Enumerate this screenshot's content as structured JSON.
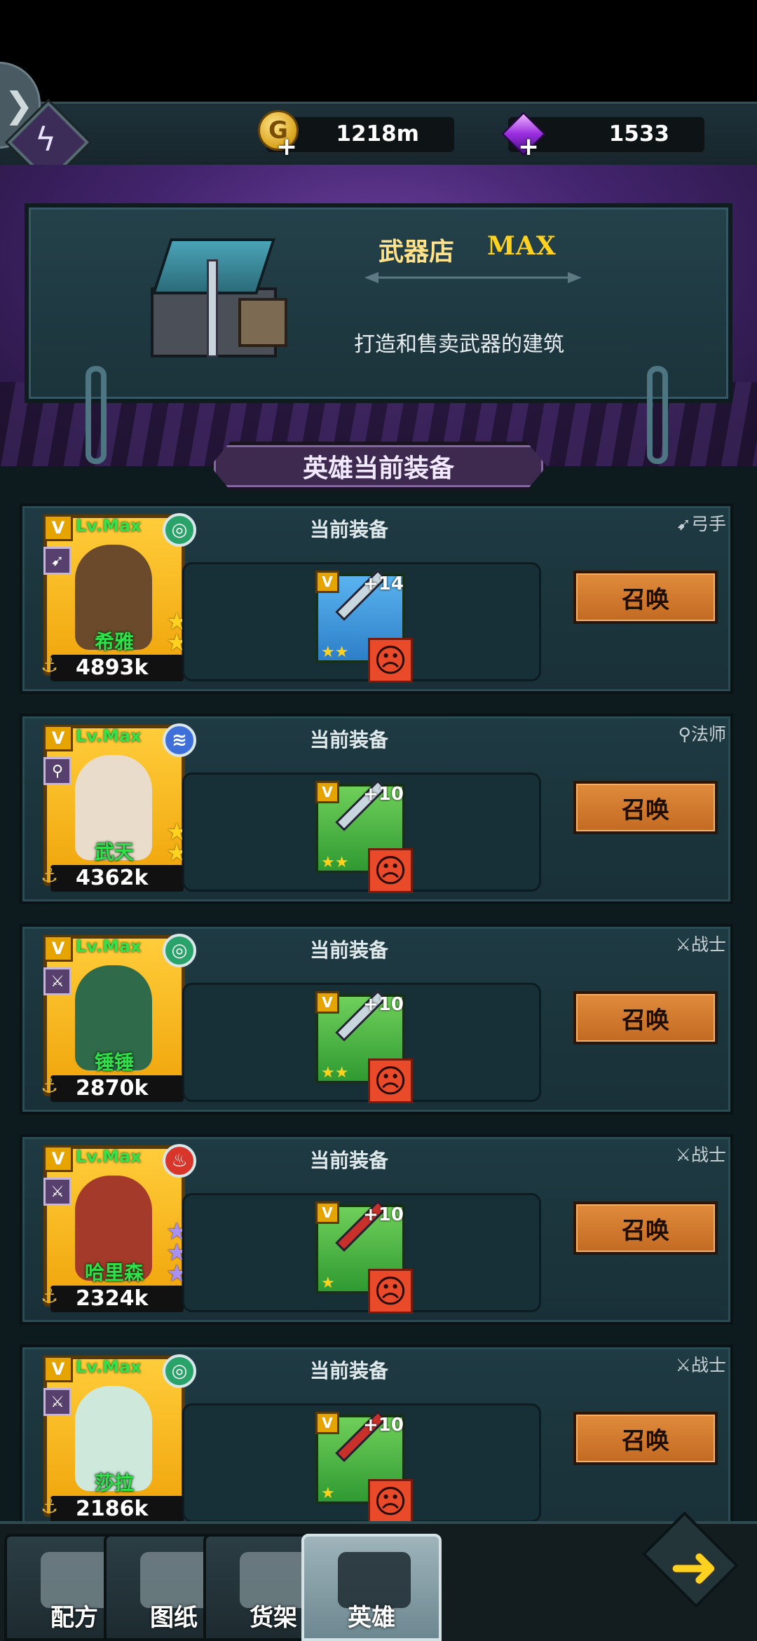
{
  "currency": {
    "gold": "1218m",
    "gems": "1533"
  },
  "shop": {
    "title": "武器店",
    "level": "MAX",
    "description": "打造和售卖武器的建筑"
  },
  "section_title": "英雄当前装备",
  "equip_label": "当前装备",
  "summon_label": "召唤",
  "heroes": [
    {
      "name": "希雅",
      "level": "Lv.Max",
      "power": "4893k",
      "role": "弓手",
      "element": "wind",
      "stars": 3,
      "star_color": "gold",
      "weapon_plus": "+14",
      "weapon_color": "blue",
      "weapon_stars": 2
    },
    {
      "name": "武天",
      "level": "Lv.Max",
      "power": "4362k",
      "role": "法师",
      "element": "water",
      "stars": 3,
      "star_color": "gold",
      "weapon_plus": "+10",
      "weapon_color": "green",
      "weapon_stars": 2
    },
    {
      "name": "锤锤",
      "level": "Lv.Max",
      "power": "2870k",
      "role": "战士",
      "element": "wind",
      "stars": 1,
      "star_color": "gold",
      "weapon_plus": "+10",
      "weapon_color": "green",
      "weapon_stars": 2
    },
    {
      "name": "哈里森",
      "level": "Lv.Max",
      "power": "2324k",
      "role": "战士",
      "element": "fire",
      "stars": 4,
      "star_color": "purple",
      "weapon_plus": "+10",
      "weapon_color": "green",
      "weapon_stars": 1
    },
    {
      "name": "莎拉",
      "level": "Lv.Max",
      "power": "2186k",
      "role": "战士",
      "element": "wind",
      "stars": 1,
      "star_color": "gold",
      "weapon_plus": "+10",
      "weapon_color": "green",
      "weapon_stars": 1
    }
  ],
  "nav": [
    {
      "label": "配方",
      "icon": "recipe-icon",
      "active": false
    },
    {
      "label": "图纸",
      "icon": "blueprint-icon",
      "active": false
    },
    {
      "label": "货架",
      "icon": "shelf-icon",
      "active": false
    },
    {
      "label": "英雄",
      "icon": "hero-icon",
      "active": true
    }
  ],
  "colors": {
    "accent": "#ffd21f",
    "summon": "#d37a30",
    "panel": "#1e3a42"
  }
}
